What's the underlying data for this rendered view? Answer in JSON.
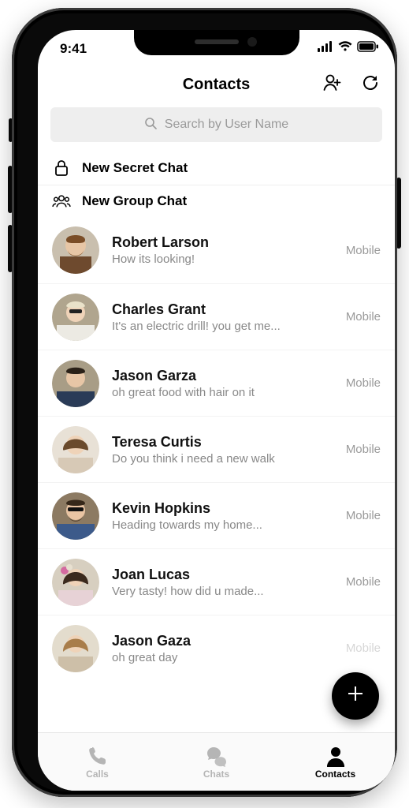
{
  "status": {
    "time": "9:41"
  },
  "header": {
    "title": "Contacts"
  },
  "search": {
    "placeholder": "Search by User Name"
  },
  "actions": {
    "secret": "New Secret Chat",
    "group": "New Group Chat"
  },
  "badge": "Mobile",
  "contacts": [
    {
      "name": "Robert Larson",
      "msg": "How its looking!"
    },
    {
      "name": "Charles Grant",
      "msg": "It's an electric drill! you get me..."
    },
    {
      "name": "Jason Garza",
      "msg": "oh great food with hair on it"
    },
    {
      "name": "Teresa Curtis",
      "msg": "Do you think i need a new walk"
    },
    {
      "name": "Kevin Hopkins",
      "msg": "Heading towards my home..."
    },
    {
      "name": "Joan Lucas",
      "msg": "Very tasty! how did u made..."
    },
    {
      "name": "Jason Gaza",
      "msg": "oh great day"
    }
  ],
  "tabs": {
    "calls": "Calls",
    "chats": "Chats",
    "contacts": "Contacts"
  }
}
